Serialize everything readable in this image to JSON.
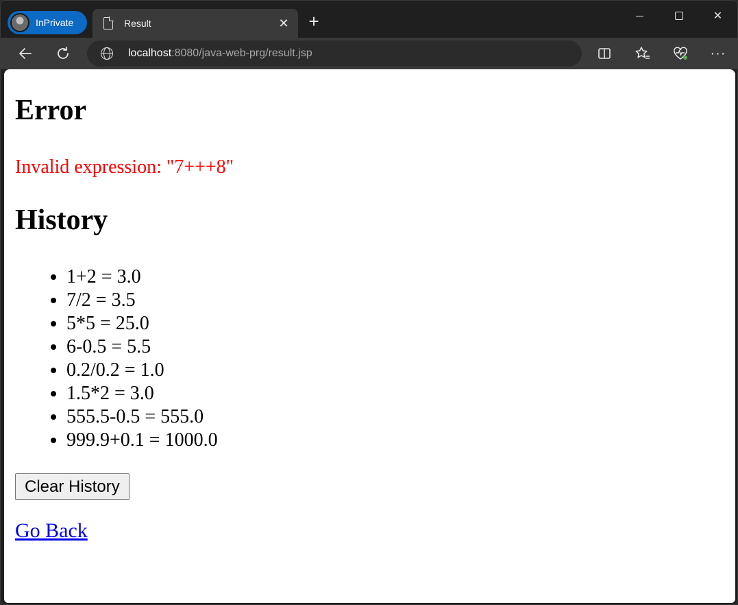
{
  "browser": {
    "profile_label": "InPrivate",
    "tab_title": "Result",
    "url_host": "localhost",
    "url_rest": ":8080/java-web-prg/result.jsp"
  },
  "page": {
    "error_heading": "Error",
    "error_message": "Invalid expression: \"7+++8\"",
    "history_heading": "History",
    "history": [
      "1+2 = 3.0",
      "7/2 = 3.5",
      "5*5 = 25.0",
      "6-0.5 = 5.5",
      "0.2/0.2 = 1.0",
      "1.5*2 = 3.0",
      "555.5-0.5 = 555.0",
      "999.9+0.1 = 1000.0"
    ],
    "clear_button": "Clear History",
    "back_link": "Go Back"
  }
}
